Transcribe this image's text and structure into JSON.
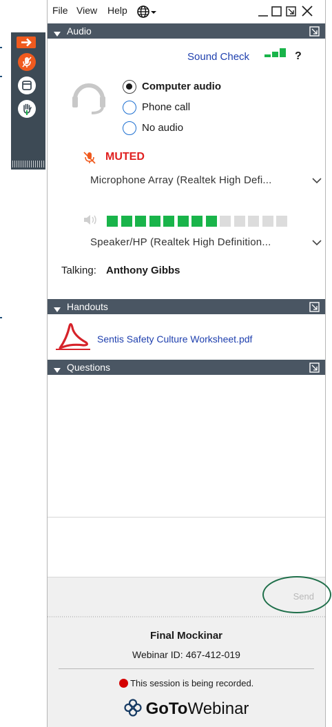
{
  "menu": {
    "file": "File",
    "view": "View",
    "help": "Help"
  },
  "colors": {
    "accent": "#f05a1e",
    "header": "#4a5663",
    "link": "#1e3fae",
    "muted": "#e02020",
    "meter_on": "#19b44a",
    "meter_off": "#dcdcdc"
  },
  "audio": {
    "header": "Audio",
    "sound_check": "Sound Check",
    "help_symbol": "?",
    "options": [
      {
        "label": "Computer audio",
        "selected": true
      },
      {
        "label": "Phone call",
        "selected": false
      },
      {
        "label": "No audio",
        "selected": false
      }
    ],
    "muted_label": "MUTED",
    "microphone": "Microphone Array (Realtek High Defi...",
    "speaker": "Speaker/HP (Realtek High Definition...",
    "speaker_level_bars_on": 8,
    "speaker_level_bars_total": 13,
    "talking_label": "Talking:",
    "talking_name": "Anthony Gibbs"
  },
  "handouts": {
    "header": "Handouts",
    "items": [
      {
        "name": "Sentis Safety Culture Worksheet.pdf",
        "icon": "pdf-icon"
      }
    ]
  },
  "questions": {
    "header": "Questions",
    "send_label": "Send"
  },
  "footer": {
    "webinar_title": "Final Mockinar",
    "webinar_id": "Webinar ID: 467-412-019",
    "recording_notice": "This session is being recorded.",
    "brand_bold": "GoTo",
    "brand_light": "Webinar"
  }
}
